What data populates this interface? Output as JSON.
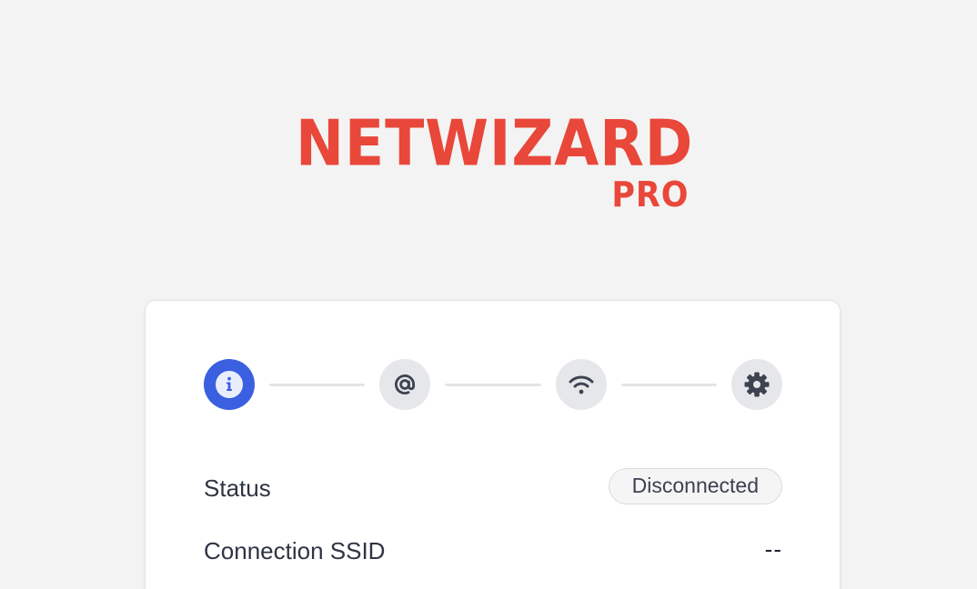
{
  "logo": {
    "name": "NETWIZARD",
    "edition": "PRO",
    "color": "#e8473a"
  },
  "stepper": {
    "active_color": "#3a5fe0",
    "inactive_color": "#e6e7ea",
    "steps": [
      {
        "icon": "info-icon",
        "active": true
      },
      {
        "icon": "at-sign-icon",
        "active": false
      },
      {
        "icon": "wifi-icon",
        "active": false
      },
      {
        "icon": "gear-icon",
        "active": false
      }
    ]
  },
  "info": {
    "status_label": "Status",
    "status_value": "Disconnected",
    "ssid_label": "Connection SSID",
    "ssid_value": "--"
  }
}
